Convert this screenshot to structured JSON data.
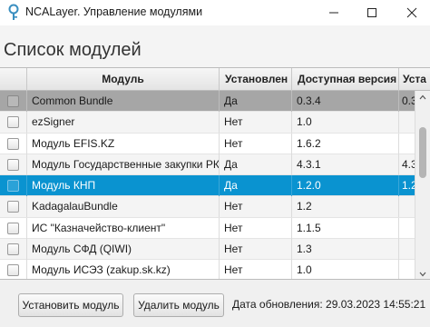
{
  "window": {
    "title": "NCALayer. Управление модулями"
  },
  "page": {
    "title": "Список модулей"
  },
  "table": {
    "columns": [
      "",
      "Модуль",
      "Установлен",
      "Доступная версия",
      "Уста"
    ],
    "rows": [
      {
        "module": "Common Bundle",
        "installed": "Да",
        "available": "0.3.4",
        "extra": "0.3"
      },
      {
        "module": "ezSigner",
        "installed": "Нет",
        "available": "1.0",
        "extra": ""
      },
      {
        "module": "Модуль EFIS.KZ",
        "installed": "Нет",
        "available": "1.6.2",
        "extra": ""
      },
      {
        "module": "Модуль Государственные закупки РК",
        "installed": "Да",
        "available": "4.3.1",
        "extra": "4.3."
      },
      {
        "module": "Модуль КНП",
        "installed": "Да",
        "available": "1.2.0",
        "extra": "1.2."
      },
      {
        "module": "KadagalauBundle",
        "installed": "Нет",
        "available": "1.2",
        "extra": ""
      },
      {
        "module": "ИС \"Казначейство-клиент\"",
        "installed": "Нет",
        "available": "1.1.5",
        "extra": ""
      },
      {
        "module": "Модуль СФД (QIWI)",
        "installed": "Нет",
        "available": "1.3",
        "extra": ""
      },
      {
        "module": "Модуль ИСЭЗ (zakup.sk.kz)",
        "installed": "Нет",
        "available": "1.0",
        "extra": ""
      }
    ],
    "selected_row": 4,
    "gray_row": 0
  },
  "footer": {
    "install_button": "Установить модуль",
    "delete_button": "Удалить модуль",
    "update_date": "Дата обновления: 29.03.2023 14:55:21"
  },
  "colors": {
    "selection": "#0a93d0",
    "gray_row": "#a6a6a6",
    "background": "#f4f4f4"
  },
  "icons": {
    "app": "ncalayer-key-icon",
    "minimize": "minimize-icon",
    "maximize": "maximize-icon",
    "close": "close-icon",
    "scroll_up": "chevron-up-icon",
    "scroll_down": "chevron-down-icon"
  }
}
